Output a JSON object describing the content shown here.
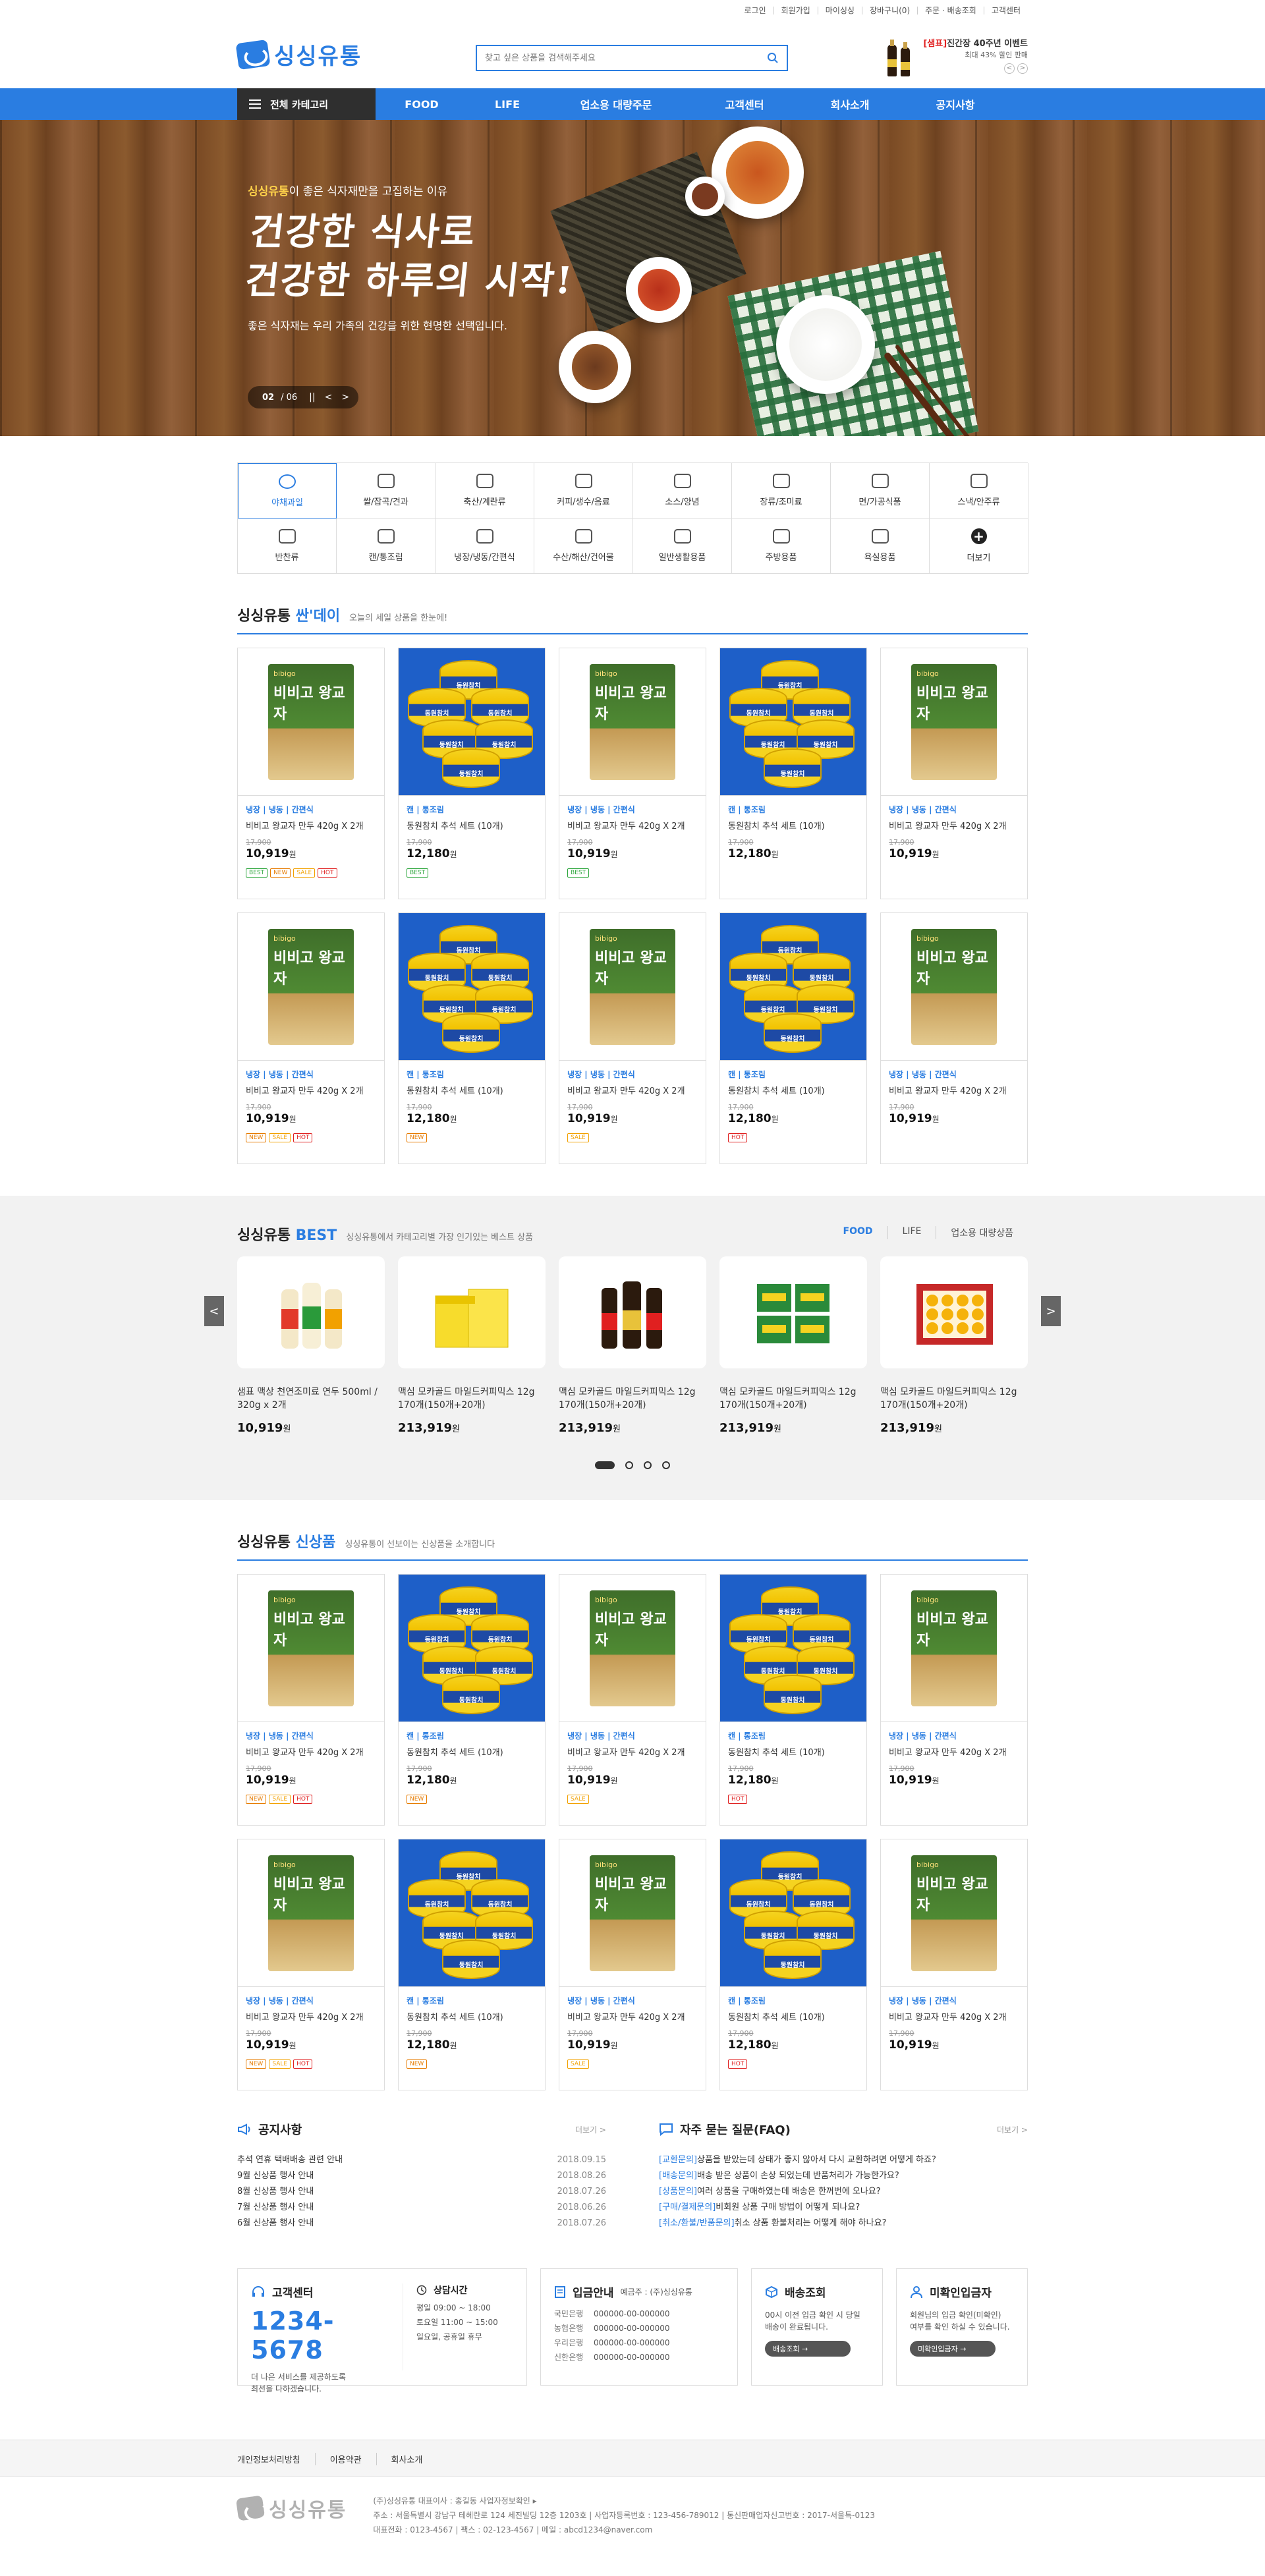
{
  "util_links": [
    "로그인",
    "회원가입",
    "마이싱싱",
    "장바구니(0)",
    "주문 · 배송조회",
    "고객센터"
  ],
  "brand": "싱싱유통",
  "logo_mark_text": "싱싱",
  "search": {
    "placeholder": "찾고 싶은 상품을 검색해주세요"
  },
  "promo": {
    "tag": "[샘표]",
    "title": "진간장 40주년 이벤트",
    "sub": "최대 43% 할인 판매",
    "prev": "<",
    "next": ">"
  },
  "nav": {
    "all": "전체 카테고리",
    "items": [
      "FOOD",
      "LIFE",
      "업소용 대량주문",
      "고객센터",
      "회사소개",
      "공지사항"
    ]
  },
  "hero": {
    "sub_brand": "싱싱유통",
    "sub_rest": "이 좋은 식자재만을 고집하는 이유",
    "title_line1": "건강한 식사로",
    "title_line2": "건강한 하루의 시작!",
    "desc": "좋은 식자재는 우리 가족의 건강을 위한 현명한 선택입니다.",
    "page_current": "02",
    "page_total": "/ 06",
    "ctrl": [
      "||",
      "<",
      ">"
    ]
  },
  "categories": [
    {
      "label": "야채과일",
      "icon": "vegetable-icon",
      "active": true
    },
    {
      "label": "쌀/잡곡/견과",
      "icon": "rice-icon"
    },
    {
      "label": "축산/계란류",
      "icon": "egg-icon"
    },
    {
      "label": "커피/생수/음료",
      "icon": "coffee-icon"
    },
    {
      "label": "소스/양념",
      "icon": "sauce-icon"
    },
    {
      "label": "장류/조미료",
      "icon": "jar-icon"
    },
    {
      "label": "면/가공식품",
      "icon": "noodle-icon"
    },
    {
      "label": "스낵/안주류",
      "icon": "snack-icon"
    },
    {
      "label": "반찬류",
      "icon": "side-dish-icon"
    },
    {
      "label": "캔/통조림",
      "icon": "can-icon"
    },
    {
      "label": "냉장/냉동/간편식",
      "icon": "frozen-icon"
    },
    {
      "label": "수산/해산/건어물",
      "icon": "fish-icon"
    },
    {
      "label": "일반생활용품",
      "icon": "living-icon"
    },
    {
      "label": "주방용품",
      "icon": "kitchen-icon"
    },
    {
      "label": "욕실용품",
      "icon": "bath-icon"
    },
    {
      "label": "더보기",
      "icon": "plus-icon"
    }
  ],
  "sale_section": {
    "title_pre": "싱싱유통 ",
    "title_accent": "싼'데이",
    "desc": "오늘의 세일 상품을 한눈에!"
  },
  "sale_products": [
    {
      "type": "dumpling",
      "cat": "냉장 | 냉동 | 간편식",
      "name": "비비고 왕교자 만두 420g X 2개",
      "orig": "17,900",
      "price": "10,919",
      "badges": [
        "BEST",
        "NEW",
        "SALE",
        "HOT"
      ]
    },
    {
      "type": "tuna",
      "cat": "캔 | 통조림",
      "name": "동원참치 추석 세트 (10개)",
      "orig": "17,900",
      "price": "12,180",
      "badges": [
        "BEST"
      ]
    },
    {
      "type": "dumpling",
      "cat": "냉장 | 냉동 | 간편식",
      "name": "비비고 왕교자 만두 420g X 2개",
      "orig": "17,900",
      "price": "10,919",
      "badges": [
        "BEST"
      ]
    },
    {
      "type": "tuna",
      "cat": "캔 | 통조림",
      "name": "동원참치 추석 세트 (10개)",
      "orig": "17,900",
      "price": "12,180",
      "badges": []
    },
    {
      "type": "dumpling",
      "cat": "냉장 | 냉동 | 간편식",
      "name": "비비고 왕교자 만두 420g X 2개",
      "orig": "17,900",
      "price": "10,919",
      "badges": []
    },
    {
      "type": "dumpling",
      "cat": "냉장 | 냉동 | 간편식",
      "name": "비비고 왕교자 만두 420g X 2개",
      "orig": "17,900",
      "price": "10,919",
      "badges": [
        "NEW",
        "SALE",
        "HOT"
      ]
    },
    {
      "type": "tuna",
      "cat": "캔 | 통조림",
      "name": "동원참치 추석 세트 (10개)",
      "orig": "17,900",
      "price": "12,180",
      "badges": [
        "NEW"
      ]
    },
    {
      "type": "dumpling",
      "cat": "냉장 | 냉동 | 간편식",
      "name": "비비고 왕교자 만두 420g X 2개",
      "orig": "17,900",
      "price": "10,919",
      "badges": [
        "SALE"
      ]
    },
    {
      "type": "tuna",
      "cat": "캔 | 통조림",
      "name": "동원참치 추석 세트 (10개)",
      "orig": "17,900",
      "price": "12,180",
      "badges": [
        "HOT"
      ]
    },
    {
      "type": "dumpling",
      "cat": "냉장 | 냉동 | 간편식",
      "name": "비비고 왕교자 만두 420g X 2개",
      "orig": "17,900",
      "price": "10,919",
      "badges": []
    }
  ],
  "best_section": {
    "title_pre": "싱싱유통 ",
    "title_accent": "BEST",
    "desc": "싱싱유통에서 카테고리별 가장 인기있는 베스트 상품",
    "tabs": [
      "FOOD",
      "LIFE",
      "업소용 대량상품"
    ],
    "prev": "<",
    "next": ">"
  },
  "best_products": [
    {
      "type": "sauce",
      "name": "샘표 맥상 천연조미료 연두 500ml / 320g x 2개",
      "price": "10,919"
    },
    {
      "type": "coffee",
      "name": "맥심 모카골드 마일드커피믹스 12g 170개(150개+20개)",
      "price": "213,919"
    },
    {
      "type": "soy",
      "name": "맥심 모카골드 마일드커피믹스 12g 170개(150개+20개)",
      "price": "213,919"
    },
    {
      "type": "laver",
      "name": "맥심 모카골드 마일드커피믹스 12g 170개(150개+20개)",
      "price": "213,919"
    },
    {
      "type": "fruit",
      "name": "맥심 모카골드 마일드커피믹스 12g 170개(150개+20개)",
      "price": "213,919"
    }
  ],
  "new_section": {
    "title_pre": "싱싱유통 ",
    "title_accent": "신상품",
    "desc": "싱싱유통이 선보이는 신상품을 소개합니다"
  },
  "new_products": [
    {
      "type": "dumpling",
      "cat": "냉장 | 냉동 | 간편식",
      "name": "비비고 왕교자 만두 420g X 2개",
      "orig": "17,900",
      "price": "10,919",
      "badges": [
        "NEW",
        "SALE",
        "HOT"
      ]
    },
    {
      "type": "tuna",
      "cat": "캔 | 통조림",
      "name": "동원참치 추석 세트 (10개)",
      "orig": "17,900",
      "price": "12,180",
      "badges": [
        "NEW"
      ]
    },
    {
      "type": "dumpling",
      "cat": "냉장 | 냉동 | 간편식",
      "name": "비비고 왕교자 만두 420g X 2개",
      "orig": "17,900",
      "price": "10,919",
      "badges": [
        "SALE"
      ]
    },
    {
      "type": "tuna",
      "cat": "캔 | 통조림",
      "name": "동원참치 추석 세트 (10개)",
      "orig": "17,900",
      "price": "12,180",
      "badges": [
        "HOT"
      ]
    },
    {
      "type": "dumpling",
      "cat": "냉장 | 냉동 | 간편식",
      "name": "비비고 왕교자 만두 420g X 2개",
      "orig": "17,900",
      "price": "10,919",
      "badges": []
    },
    {
      "type": "dumpling",
      "cat": "냉장 | 냉동 | 간편식",
      "name": "비비고 왕교자 만두 420g X 2개",
      "orig": "17,900",
      "price": "10,919",
      "badges": [
        "NEW",
        "SALE",
        "HOT"
      ]
    },
    {
      "type": "tuna",
      "cat": "캔 | 통조림",
      "name": "동원참치 추석 세트 (10개)",
      "orig": "17,900",
      "price": "12,180",
      "badges": [
        "NEW"
      ]
    },
    {
      "type": "dumpling",
      "cat": "냉장 | 냉동 | 간편식",
      "name": "비비고 왕교자 만두 420g X 2개",
      "orig": "17,900",
      "price": "10,919",
      "badges": [
        "SALE"
      ]
    },
    {
      "type": "tuna",
      "cat": "캔 | 통조림",
      "name": "동원참치 추석 세트 (10개)",
      "orig": "17,900",
      "price": "12,180",
      "badges": [
        "HOT"
      ]
    },
    {
      "type": "dumpling",
      "cat": "냉장 | 냉동 | 간편식",
      "name": "비비고 왕교자 만두 420g X 2개",
      "orig": "17,900",
      "price": "10,919",
      "badges": []
    }
  ],
  "product_labels": {
    "dumpling_brand": "bibigo",
    "dumpling_title": "비비고 왕교자",
    "tuna_can": "동원참치",
    "won": "원"
  },
  "notice": {
    "title": "공지사항",
    "more": "더보기 >",
    "items": [
      {
        "title": "추석 연휴 택배배송 관련 안내",
        "date": "2018.09.15"
      },
      {
        "title": "9월 신상품 행사 안내",
        "date": "2018.08.26"
      },
      {
        "title": "8월 신상품 행사 안내",
        "date": "2018.07.26"
      },
      {
        "title": "7월 신상품 행사 안내",
        "date": "2018.06.26"
      },
      {
        "title": "6월 신상품 행사 안내",
        "date": "2018.07.26"
      }
    ]
  },
  "faq": {
    "title": "자주 묻는 질문(FAQ)",
    "more": "더보기 >",
    "items": [
      {
        "tag": "[교환문의]",
        "q": "상품을 받았는데 상태가 좋지 않아서 다시 교환하려면 어떻게 하죠?"
      },
      {
        "tag": "[배송문의]",
        "q": "배송 받은 상품이 손상 되었는데 반품처리가 가능한가요?"
      },
      {
        "tag": "[상품문의]",
        "q": "여러 상품을 구매하였는데 배송은 한꺼번에 오나요?"
      },
      {
        "tag": "[구매/결제문의]",
        "q": "비회원 상품 구매 방법이 어떻게 되나요?"
      },
      {
        "tag": "[취소/환불/반품문의]",
        "q": "취소 상품 환불처리는 어떻게 해야 하나요?"
      }
    ]
  },
  "service": {
    "center_title": "고객센터",
    "phone": "1234-5678",
    "center_desc1": "더 나은 서비스를 제공하도록",
    "center_desc2": "최선을 다하겠습니다.",
    "hours_title": "상담시간",
    "hours": [
      "평일 09:00 ~ 18:00",
      "토요일 11:00 ~ 15:00",
      "일요일, 공휴일 휴무"
    ],
    "deposit_title": "입금안내",
    "deposit_holder": "예금주 : (주)싱싱유통",
    "banks": [
      {
        "bank": "국민은행",
        "acct": "000000-00-000000"
      },
      {
        "bank": "농협은행",
        "acct": "000000-00-000000"
      },
      {
        "bank": "우리은행",
        "acct": "000000-00-000000"
      },
      {
        "bank": "신한은행",
        "acct": "000000-00-000000"
      }
    ],
    "delivery_title": "배송조회",
    "delivery_desc1": "00시 이전 입금 확인 시 당일",
    "delivery_desc2": "배송이 완료됩니다.",
    "delivery_btn": "배송조회 →",
    "unconfirmed_title": "미확인입금자",
    "unconfirmed_desc1": "회원님의 입금 확인(미확인)",
    "unconfirmed_desc2": "여부를 확인 하실 수 있습니다.",
    "unconfirmed_btn": "미확인입금자 →"
  },
  "footer": {
    "links": [
      "개인정보처리방침",
      "이용약관",
      "회사소개"
    ],
    "line1": "(주)싱싱유통   대표이사 : 홍길동   사업자정보확인 ▸",
    "line2": "주소 : 서울특별시 강남구 테헤란로 124 세진빌딩 12층 1203호   |   사업자등록번호 : 123-456-789012   |   통신판매업자신고번호 : 2017-서울특-0123",
    "line3": "대표전화 : 0123-4567   |   팩스 : 02-123-4567   |   메일 : abcd1234@naver.com"
  }
}
